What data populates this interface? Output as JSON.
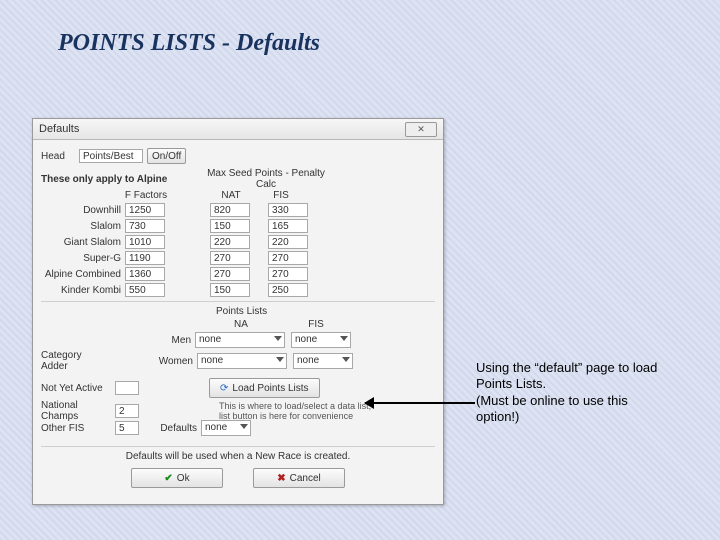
{
  "slide": {
    "title": "POINTS LISTS - Defaults"
  },
  "window": {
    "title": "Defaults",
    "head_label": "Head",
    "head_value": "Points/Best",
    "on_off_label": "On/Off",
    "alpine_note": "These only apply to Alpine",
    "f_factors": "F Factors",
    "col_nat": "NAT",
    "col_fis": "FIS",
    "max_seed": "Max Seed Points - Penalty Calc",
    "rows": [
      {
        "label": "Downhill",
        "f": "1250",
        "nat": "820",
        "fis": "330"
      },
      {
        "label": "Slalom",
        "f": "730",
        "nat": "150",
        "fis": "165"
      },
      {
        "label": "Giant Slalom",
        "f": "1010",
        "nat": "220",
        "fis": "220"
      },
      {
        "label": "Super-G",
        "f": "1190",
        "nat": "270",
        "fis": "270"
      },
      {
        "label": "Alpine Combined",
        "f": "1360",
        "nat": "270",
        "fis": "270"
      },
      {
        "label": "Kinder Kombi",
        "f": "550",
        "nat": "150",
        "fis": "250"
      }
    ],
    "points_lists_label": "Points Lists",
    "pl_na": "NA",
    "pl_fis": "FIS",
    "men_label": "Men",
    "women_label": "Women",
    "none": "none",
    "category_adder": "Category Adder",
    "not_yet_active": "Not Yet Active",
    "nya_val": "",
    "national_champs": "National Champs",
    "nc_val": "2",
    "other_fis": "Other FIS",
    "of_val": "5",
    "load_points_btn": "Load Points Lists",
    "load_hint": "This is where to load/select a data list, list button is here for convenience",
    "defaults_label": "Defaults",
    "defaults_val": "none",
    "footer_note": "Defaults will be used when a New Race is created.",
    "ok": "Ok",
    "cancel": "Cancel"
  },
  "annotation": {
    "text1": "Using the “default” page to load Points Lists.",
    "text2": "(Must be online to use this option!)"
  }
}
